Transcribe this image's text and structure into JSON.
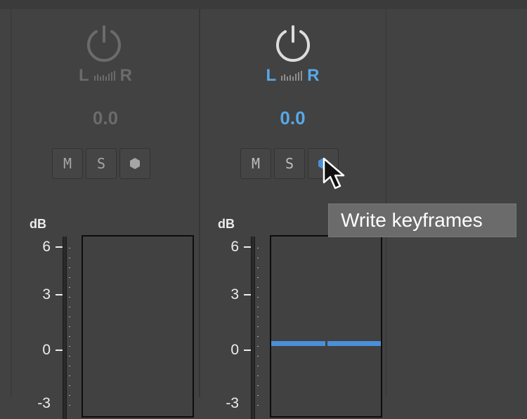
{
  "channels": [
    {
      "pan_left": "L",
      "pan_right": "R",
      "pan_value": "0.0",
      "mute_label": "M",
      "solo_label": "S",
      "state": "inactive"
    },
    {
      "pan_left": "L",
      "pan_right": "R",
      "pan_value": "0.0",
      "mute_label": "M",
      "solo_label": "S",
      "state": "active",
      "fader_level_db": 0
    }
  ],
  "scale": {
    "unit_label": "dB",
    "ticks": [
      "6",
      "3",
      "0",
      "-3"
    ]
  },
  "tooltip": {
    "text": "Write keyframes"
  },
  "icons": {
    "pan_knob": "power-knob-icon",
    "write_keyframe": "keyframe-diamond-icon",
    "cursor": "arrow-cursor-icon"
  },
  "colors": {
    "accent": "#56a8e8",
    "fader_level": "#4a8fd8",
    "panel": "#424242"
  }
}
